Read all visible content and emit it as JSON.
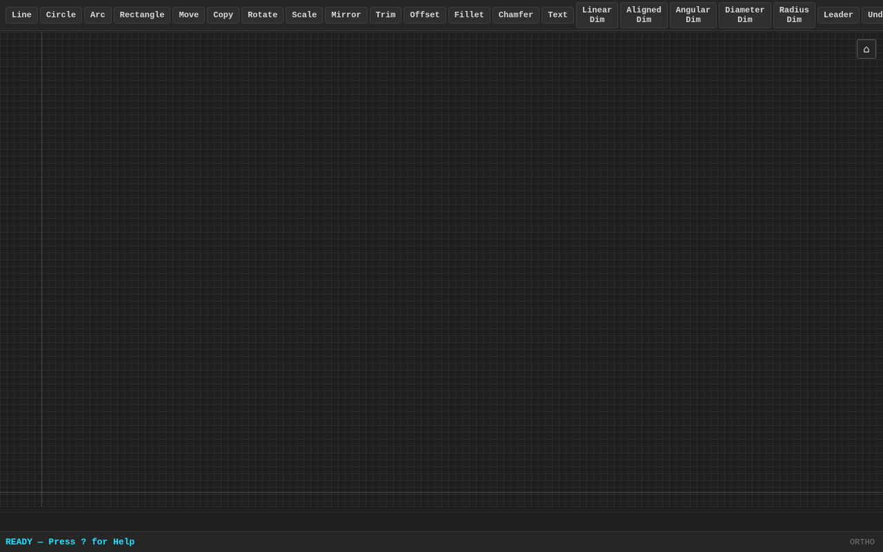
{
  "toolbar": {
    "line": "Line",
    "circle": "Circle",
    "arc": "Arc",
    "rectangle": "Rectangle",
    "move": "Move",
    "copy": "Copy",
    "rotate": "Rotate",
    "scale": "Scale",
    "mirror": "Mirror",
    "trim": "Trim",
    "offset": "Offset",
    "fillet": "Fillet",
    "chamfer": "Chamfer",
    "text": "Text",
    "linear_dim": [
      "Linear",
      "Dim"
    ],
    "aligned_dim": [
      "Aligned",
      "Dim"
    ],
    "angular_dim": [
      "Angular",
      "Dim"
    ],
    "diameter_dim": [
      "Diameter",
      "Dim"
    ],
    "radius_dim": [
      "Radius",
      "Dim"
    ],
    "leader": "Leader",
    "undo": "Undo"
  },
  "canvas": {
    "home_icon": "home-icon",
    "home_glyph": "⌂"
  },
  "command": {
    "value": "",
    "placeholder": ""
  },
  "status": {
    "text": "READY — Press ? for Help",
    "ortho": "ORTHO"
  },
  "colors": {
    "status_accent": "#22e0ff",
    "background": "#1e1e1e",
    "ortho_inactive": "#777777"
  }
}
